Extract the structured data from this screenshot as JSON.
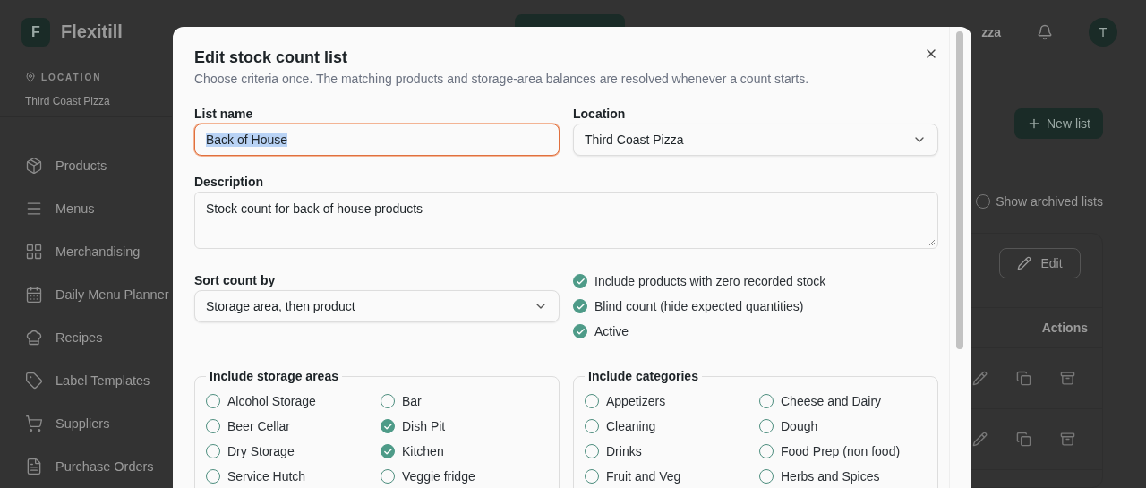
{
  "app": {
    "logo_letter": "F",
    "name": "Flexitill"
  },
  "header": {
    "location_partial": "zza",
    "avatar_initial": "T"
  },
  "sidebar": {
    "location_label": "LOCATION",
    "location": "Third Coast Pizza",
    "items": [
      {
        "label": "Products"
      },
      {
        "label": "Menus"
      },
      {
        "label": "Merchandising"
      },
      {
        "label": "Daily Menu Planner"
      },
      {
        "label": "Recipes"
      },
      {
        "label": "Label Templates"
      },
      {
        "label": "Suppliers"
      },
      {
        "label": "Purchase Orders"
      }
    ]
  },
  "main": {
    "new_list_button": "New list",
    "show_archived": {
      "label": "Show archived lists",
      "checked": false
    },
    "edit_button": "Edit",
    "table": {
      "columns": [
        "Actions"
      ]
    }
  },
  "modal": {
    "title": "Edit stock count list",
    "subtitle": "Choose criteria once. The matching products and storage-area balances are resolved whenever a count starts.",
    "list_name": {
      "label": "List name",
      "value": "Back of House",
      "focused": true
    },
    "location": {
      "label": "Location",
      "value": "Third Coast Pizza"
    },
    "description": {
      "label": "Description",
      "value": "Stock count for back of house products"
    },
    "sort": {
      "label": "Sort count by",
      "value": "Storage area, then product"
    },
    "options": [
      {
        "label": "Include products with zero recorded stock",
        "checked": true
      },
      {
        "label": "Blind count (hide expected quantities)",
        "checked": true
      },
      {
        "label": "Active",
        "checked": true
      }
    ],
    "storage_areas": {
      "legend": "Include storage areas",
      "items": [
        {
          "label": "Alcohol Storage",
          "checked": false
        },
        {
          "label": "Bar",
          "checked": false
        },
        {
          "label": "Beer Cellar",
          "checked": false
        },
        {
          "label": "Dish Pit",
          "checked": true
        },
        {
          "label": "Dry Storage",
          "checked": false
        },
        {
          "label": "Kitchen",
          "checked": true
        },
        {
          "label": "Service Hutch",
          "checked": false
        },
        {
          "label": "Veggie fridge",
          "checked": false
        }
      ]
    },
    "categories": {
      "legend": "Include categories",
      "items": [
        {
          "label": "Appetizers",
          "checked": false
        },
        {
          "label": "Cheese and Dairy",
          "checked": false
        },
        {
          "label": "Cleaning",
          "checked": false
        },
        {
          "label": "Dough",
          "checked": false
        },
        {
          "label": "Drinks",
          "checked": false
        },
        {
          "label": "Food Prep (non food)",
          "checked": false
        },
        {
          "label": "Fruit and Veg",
          "checked": false
        },
        {
          "label": "Herbs and Spices",
          "checked": false
        }
      ]
    }
  }
}
